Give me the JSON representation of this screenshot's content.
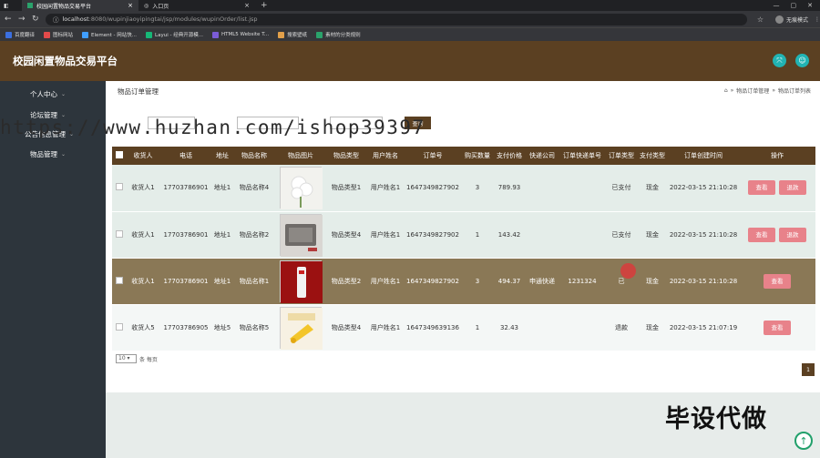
{
  "browser": {
    "tabs": [
      {
        "title": "校园闲置物品交易平台",
        "active": true
      },
      {
        "title": "入口页",
        "active": false
      }
    ],
    "url_host": "localhost",
    "url_rest": ":8080/wupinjiaoyipingtai/jsp/modules/wupinOrder/list.jsp",
    "profile_label": "无痕模式",
    "bookmarks": [
      {
        "label": "百度翻译",
        "color": "#3b6fe0"
      },
      {
        "label": "图标网站",
        "color": "#e24a4a"
      },
      {
        "label": "Element - 网站快...",
        "color": "#409eff"
      },
      {
        "label": "Layui - 经典开源模...",
        "color": "#16b777"
      },
      {
        "label": "HTML5 Website T...",
        "color": "#7b5cd6"
      },
      {
        "label": "搜索壁纸",
        "color": "#e2a04a"
      },
      {
        "label": "素材的分类规则",
        "color": "#2aa26b"
      }
    ]
  },
  "header": {
    "title": "校园闲置物品交易平台"
  },
  "sidebar": {
    "items": [
      "个人中心",
      "论坛管理",
      "公告信息管理",
      "物品管理"
    ]
  },
  "page": {
    "title": "物品订单管理",
    "breadcrumb": [
      "物品订单管理",
      "物品订单列表"
    ],
    "watermark": "https://www.huzhan.com/ishop39397",
    "search_button": "查询"
  },
  "table": {
    "headers": [
      "收货人",
      "电话",
      "地址",
      "物品名称",
      "物品图片",
      "物品类型",
      "用户姓名",
      "订单号",
      "购买数量",
      "支付价格",
      "快递公司",
      "订单快递单号",
      "订单类型",
      "支付类型",
      "订单创建时间",
      "操作"
    ],
    "rows": [
      {
        "receiver": "收货人1",
        "phone": "17703786901",
        "address": "地址1",
        "name": "物品名称4",
        "image": "white-flowers",
        "type": "物品类型1",
        "user": "用户姓名1",
        "order": "1647349827902",
        "qty": "3",
        "price": "789.93",
        "courier": "",
        "tracking": "",
        "status": "已支付",
        "pay": "现金",
        "time": "2022-03-15 21:10:28",
        "actions": [
          "查看",
          "退款"
        ]
      },
      {
        "receiver": "收货人1",
        "phone": "17703786901",
        "address": "地址1",
        "name": "物品名称2",
        "image": "gray-device",
        "type": "物品类型4",
        "user": "用户姓名1",
        "order": "1647349827902",
        "qty": "1",
        "price": "143.42",
        "courier": "",
        "tracking": "",
        "status": "已支付",
        "pay": "现金",
        "time": "2022-03-15 21:10:28",
        "actions": [
          "查看",
          "退款"
        ]
      },
      {
        "receiver": "收货人1",
        "phone": "17703786901",
        "address": "地址1",
        "name": "物品名称1",
        "image": "red-product",
        "type": "物品类型2",
        "user": "用户姓名1",
        "order": "1647349827902",
        "qty": "3",
        "price": "494.37",
        "courier": "申通快递",
        "tracking": "1231324",
        "status": "已",
        "pay": "现金",
        "time": "2022-03-15 21:10:28",
        "actions": [
          "查看"
        ]
      },
      {
        "receiver": "收货人5",
        "phone": "17703786905",
        "address": "地址5",
        "name": "物品名称5",
        "image": "yellow-product",
        "type": "物品类型4",
        "user": "用户姓名1",
        "order": "1647349639136",
        "qty": "1",
        "price": "32.43",
        "courier": "",
        "tracking": "",
        "status": "退款",
        "pay": "现金",
        "time": "2022-03-15 21:07:19",
        "actions": [
          "查看"
        ]
      }
    ]
  },
  "footer": {
    "page_size": "10",
    "page_size_suffix": "条 每页",
    "current_page": "1"
  },
  "overlay_text": "毕设代做"
}
